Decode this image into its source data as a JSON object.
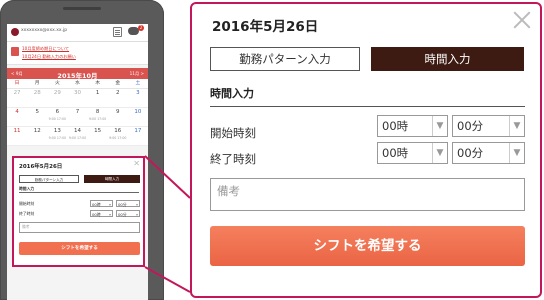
{
  "header": {
    "email": "xxxxxxxx@xxx.xx.jp",
    "chat_badge": "2"
  },
  "notice": {
    "line1": "10月度締め期日について",
    "line2": "10月24日 勤務入力のお願い"
  },
  "calendar": {
    "prev_label": "< 9月",
    "next_label": "11月 >",
    "title": "2015年10月",
    "weekdays": [
      "日",
      "月",
      "火",
      "水",
      "木",
      "金",
      "土"
    ],
    "rows": [
      [
        {
          "d": "27",
          "t": ""
        },
        {
          "d": "28",
          "t": ""
        },
        {
          "d": "29",
          "t": ""
        },
        {
          "d": "30",
          "t": ""
        },
        {
          "d": "1",
          "t": ""
        },
        {
          "d": "2",
          "t": ""
        },
        {
          "d": "3",
          "t": ""
        }
      ],
      [
        {
          "d": "4",
          "t": ""
        },
        {
          "d": "5",
          "t": ""
        },
        {
          "d": "6",
          "t": "9:00 17:00"
        },
        {
          "d": "7",
          "t": ""
        },
        {
          "d": "8",
          "t": "9:00 17:00"
        },
        {
          "d": "9",
          "t": ""
        },
        {
          "d": "10",
          "t": ""
        }
      ],
      [
        {
          "d": "11",
          "t": ""
        },
        {
          "d": "12",
          "t": ""
        },
        {
          "d": "13",
          "t": "9:00 17:00"
        },
        {
          "d": "14",
          "t": "9:00 17:00"
        },
        {
          "d": "15",
          "t": ""
        },
        {
          "d": "16",
          "t": "9:00 17:00"
        },
        {
          "d": "17",
          "t": ""
        }
      ]
    ]
  },
  "modal": {
    "date": "2016年5月26日",
    "tab_pattern": "勤務パターン入力",
    "tab_time": "時間入力",
    "section_title": "時間入力",
    "start_label": "開始時刻",
    "end_label": "終了時刻",
    "start_hour": "00時",
    "start_min": "00分",
    "end_hour": "00時",
    "end_min": "00分",
    "memo_placeholder": "備考",
    "submit_label": "シフトを希望する"
  },
  "colors": {
    "accent": "#c2185b",
    "active_tab": "#3d1a12",
    "submit": "#ee6b4b",
    "calendar_header": "#d9534f"
  }
}
